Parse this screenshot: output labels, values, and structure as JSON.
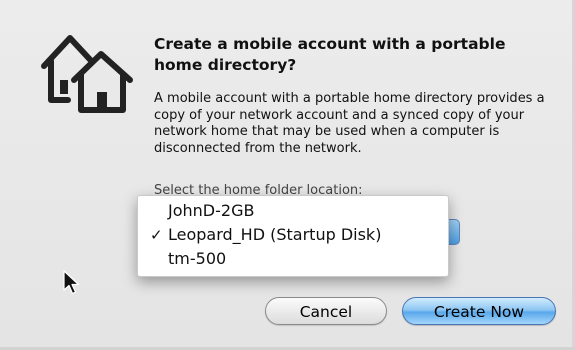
{
  "dialog": {
    "title": "Create a mobile account with a portable home directory?",
    "message": "A mobile account with a portable home directory provides a copy of your network account and a synced copy of your network home that may be used when a computer is disconnected from the network.",
    "popup_label_partial": "Select the home folder location:",
    "icon": "houses-icon"
  },
  "popup_menu": {
    "items": [
      {
        "label": "JohnD-2GB",
        "checked": false
      },
      {
        "label": "Leopard_HD (Startup Disk)",
        "checked": true
      },
      {
        "label": "tm-500",
        "checked": false
      }
    ],
    "check_glyph": "✓"
  },
  "buttons": {
    "cancel_label": "Cancel",
    "create_label": "Create Now"
  },
  "colors": {
    "default_button": "#5aa8ea",
    "popup_accent": "#4f9ee2"
  }
}
